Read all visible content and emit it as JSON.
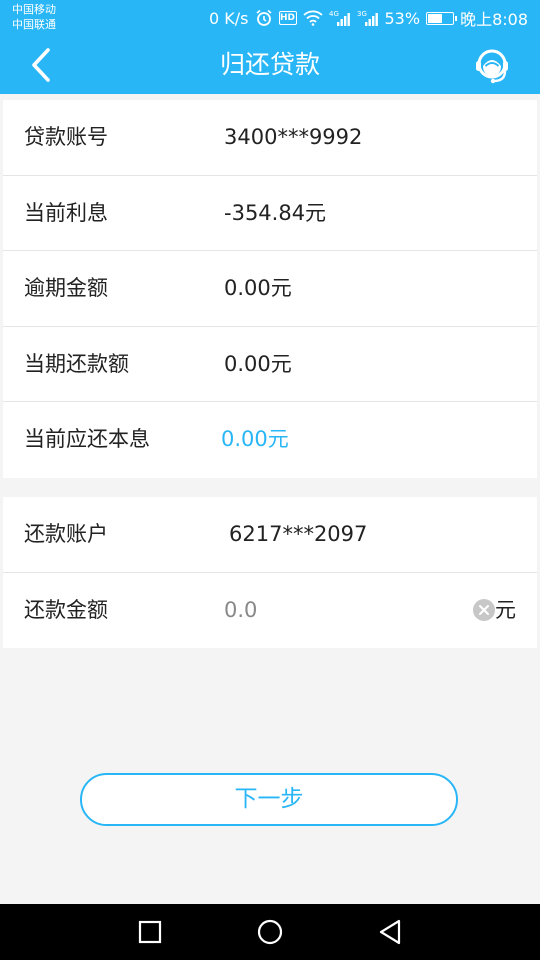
{
  "statusbar": {
    "carrier1": "中国移动",
    "carrier2": "中国联通",
    "speed": "0 K/s",
    "battery": "53%",
    "battery_level": 0.53,
    "time": "晚上8:08",
    "icons": [
      "alarm-icon",
      "hd-icon",
      "wifi-icon",
      "signal-4g-icon",
      "signal-3g-icon",
      "battery-icon"
    ]
  },
  "appbar": {
    "title": "归还贷款",
    "back_icon": "chevron-left-icon",
    "service_icon": "customer-service-icon"
  },
  "loan_info": {
    "rows": [
      {
        "label": "贷款账号",
        "value": "3400***9992"
      },
      {
        "label": "当前利息",
        "value": "-354.84元"
      },
      {
        "label": "逾期金额",
        "value": "0.00元"
      },
      {
        "label": "当期还款额",
        "value": "0.00元"
      },
      {
        "label": "当前应还本息",
        "value": "0.00元"
      }
    ]
  },
  "repay_form": {
    "account_label": "还款账户",
    "account_value": "6217***2097",
    "amount_label": "还款金额",
    "amount_value": "0.0",
    "amount_unit": "元"
  },
  "actions": {
    "next_label": "下一步"
  },
  "colors": {
    "primary": "#29b6f6",
    "background": "#f4f4f4",
    "text": "#222222"
  }
}
